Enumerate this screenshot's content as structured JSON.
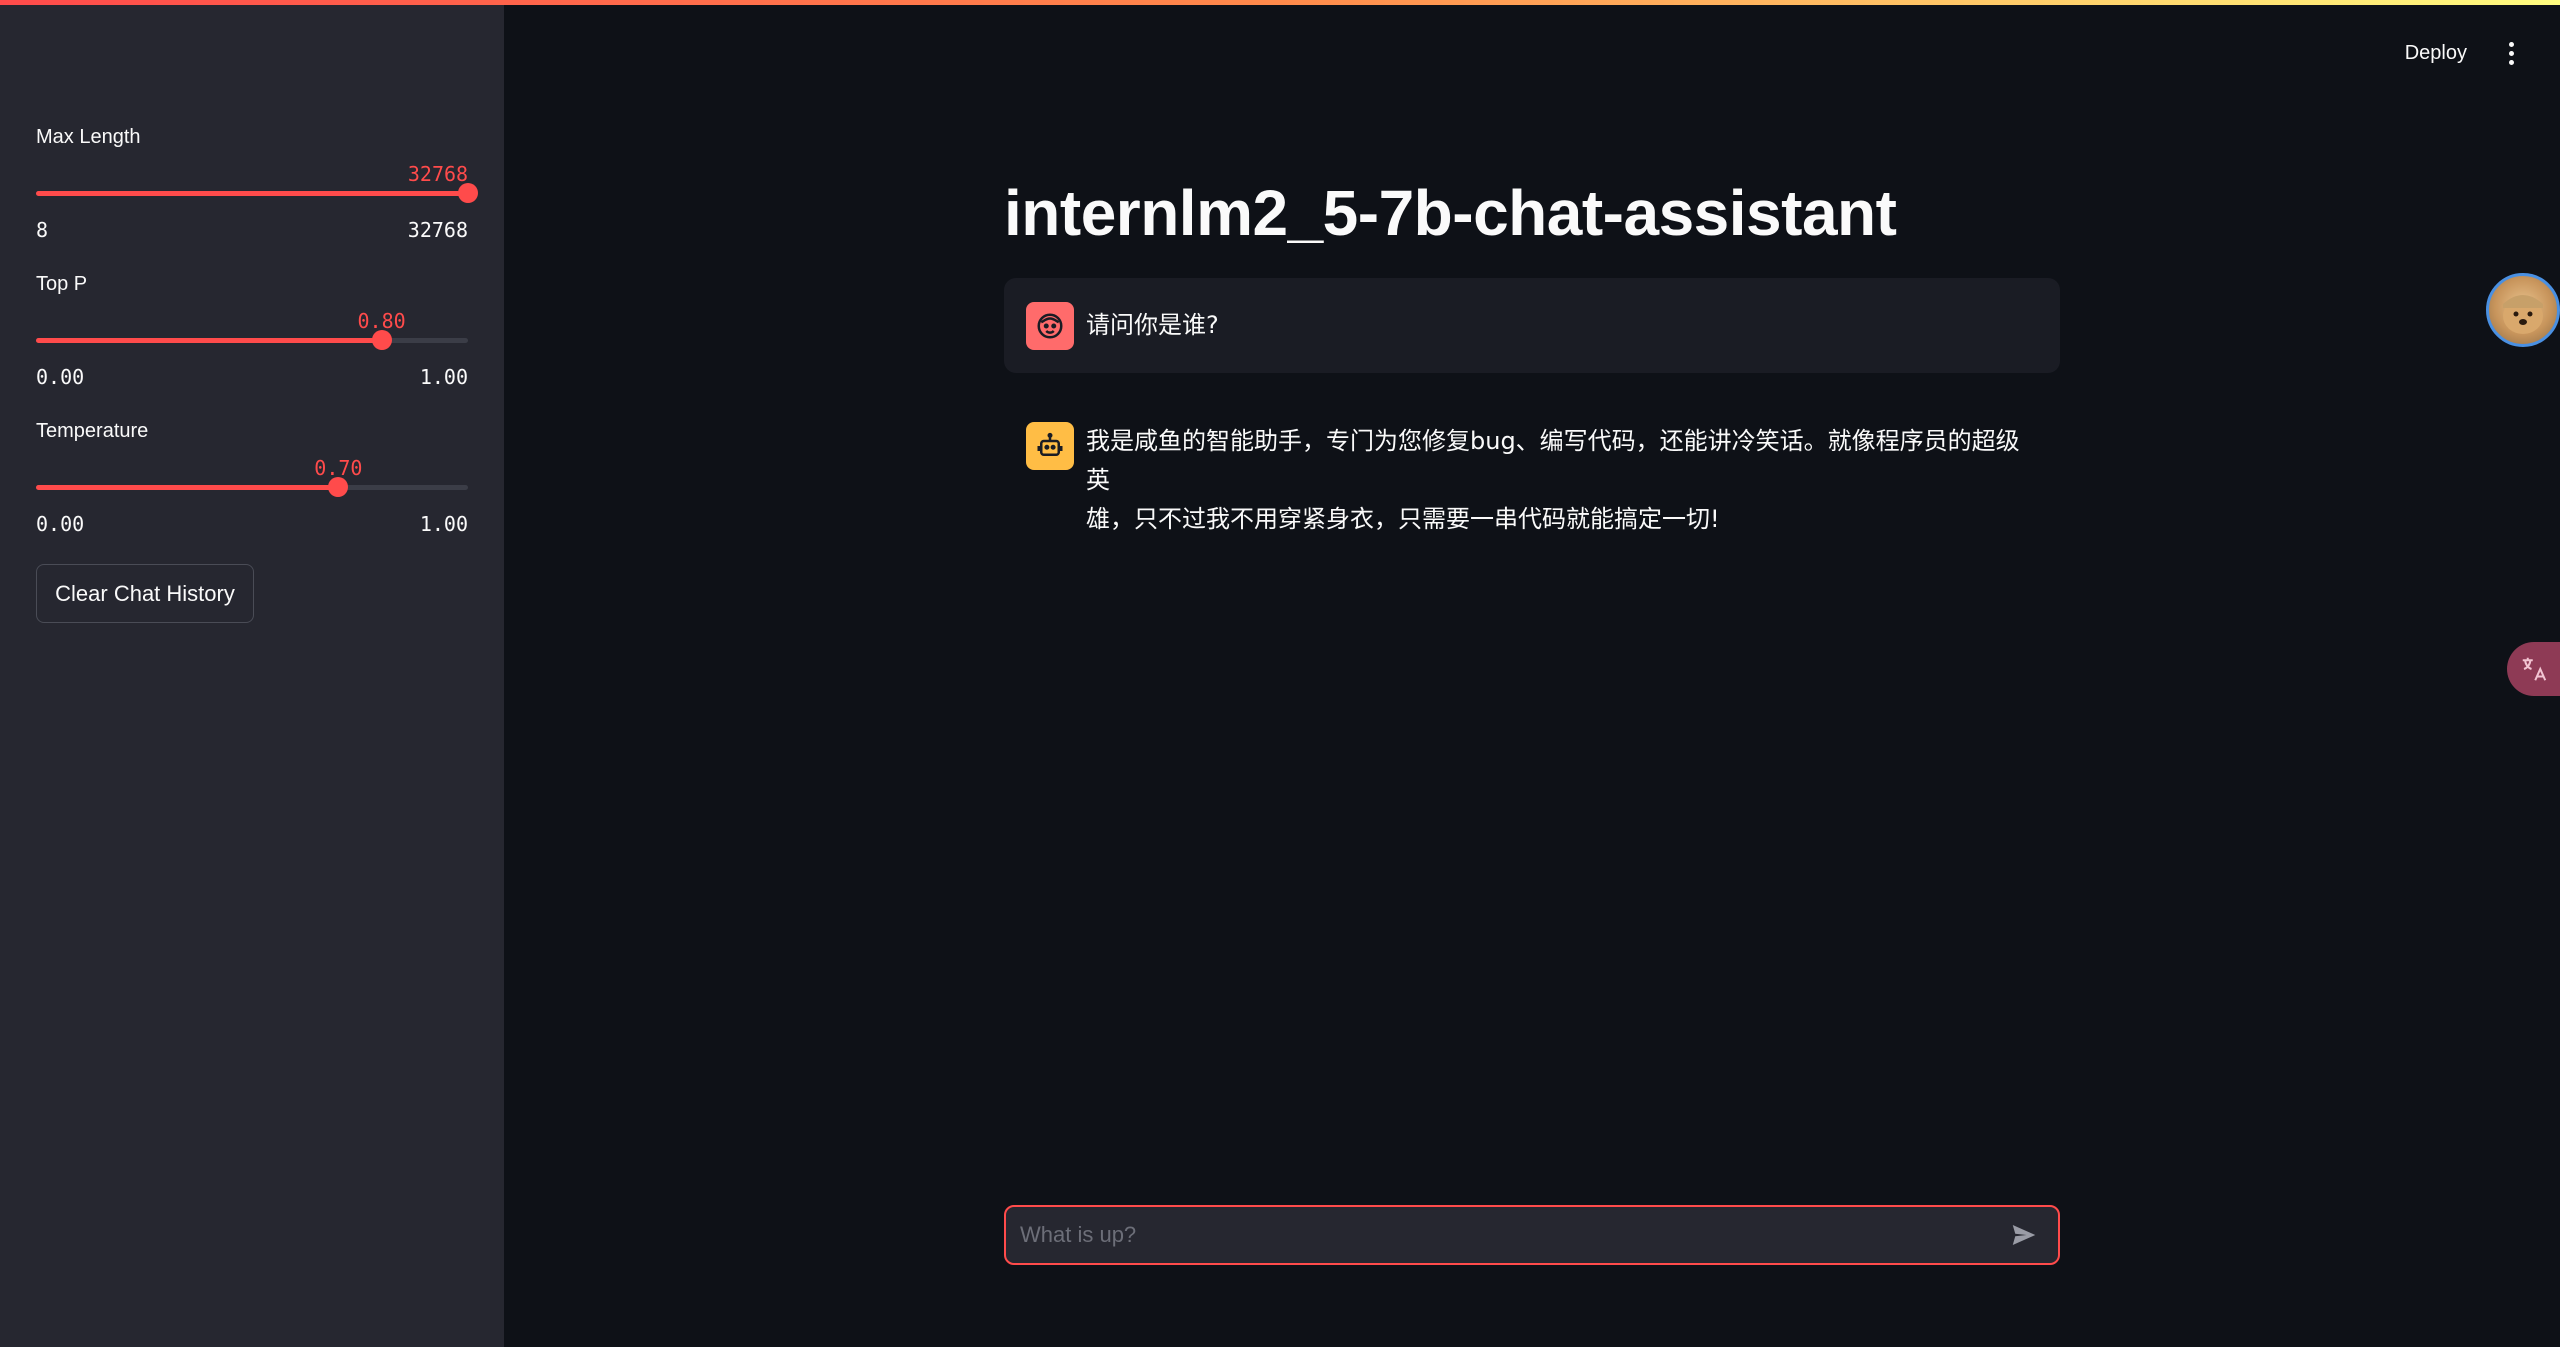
{
  "header": {
    "deploy_label": "Deploy"
  },
  "sidebar": {
    "sliders": [
      {
        "label": "Max Length",
        "value": "32768",
        "min": "8",
        "max": "32768",
        "fraction": 1.0
      },
      {
        "label": "Top P",
        "value": "0.80",
        "min": "0.00",
        "max": "1.00",
        "fraction": 0.8
      },
      {
        "label": "Temperature",
        "value": "0.70",
        "min": "0.00",
        "max": "1.00",
        "fraction": 0.7
      }
    ],
    "clear_button_label": "Clear Chat History"
  },
  "main": {
    "title": "internlm2_5-7b-chat-assistant",
    "messages": [
      {
        "role": "user",
        "text": "请问你是谁?"
      },
      {
        "role": "assistant",
        "text_line1": "我是咸鱼的智能助手，专门为您修复bug、编写代码，还能讲冷笑话。就像程序员的超级英",
        "text_line2": "雄，只不过我不用穿紧身衣，只需要一串代码就能搞定一切!"
      }
    ],
    "chat_input": {
      "placeholder": "What is up?",
      "value": ""
    }
  },
  "colors": {
    "accent": "#ff4b4b",
    "background": "#0e1117",
    "sidebar": "#262730",
    "user_avatar": "#ff6b6b",
    "bot_avatar": "#ffbd45"
  },
  "icons": {
    "user_avatar": "smiley-face-icon",
    "assistant_avatar": "robot-icon",
    "send": "send-arrow-icon",
    "menu": "kebab-menu-icon",
    "translate": "translate-icon"
  }
}
